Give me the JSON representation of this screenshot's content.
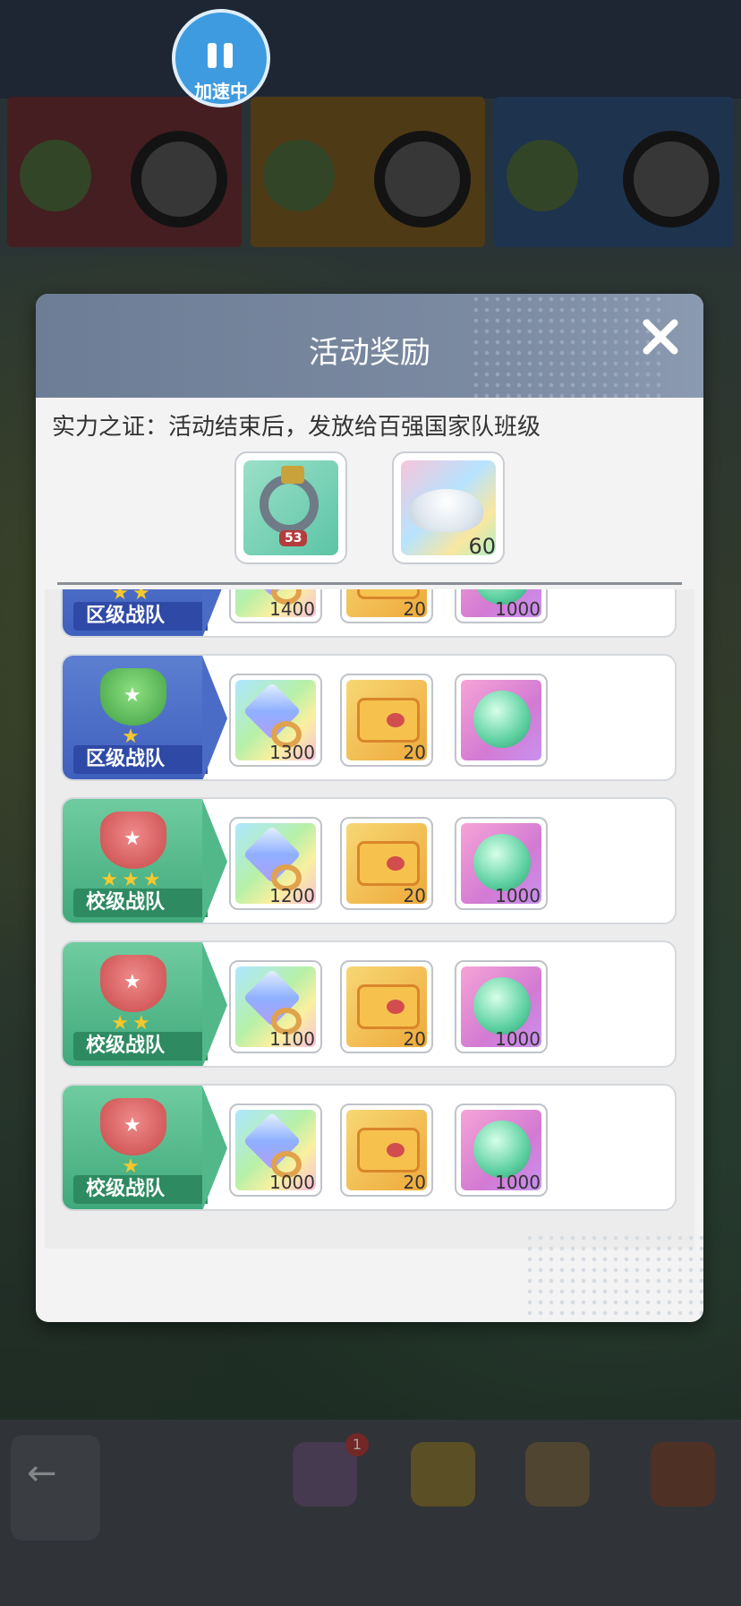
{
  "speed_button": {
    "label": "加速中"
  },
  "modal": {
    "title": "活动奖励",
    "description": "实力之证：活动结束后，发放给百强国家队班级",
    "top_rewards": [
      {
        "icon": "avatar-frame-icon",
        "label": ""
      },
      {
        "icon": "powder-icon",
        "count": "60"
      }
    ],
    "tiers": [
      {
        "rank_label": "区级战队",
        "stars": "★★",
        "medal": "district",
        "rewards": [
          "1400",
          "20",
          "1000"
        ]
      },
      {
        "rank_label": "区级战队",
        "stars": "★",
        "medal": "district",
        "rewards": [
          "1300",
          "20",
          ""
        ]
      },
      {
        "rank_label": "校级战队",
        "stars": "★★★",
        "medal": "school",
        "rewards": [
          "1200",
          "20",
          "1000"
        ]
      },
      {
        "rank_label": "校级战队",
        "stars": "★★",
        "medal": "school",
        "rewards": [
          "1100",
          "20",
          "1000"
        ]
      },
      {
        "rank_label": "校级战队",
        "stars": "★",
        "medal": "school",
        "rewards": [
          "1000",
          "20",
          "1000"
        ]
      }
    ]
  },
  "background": {
    "badge_count": "1"
  },
  "colors": {
    "header": "#7c8ba2",
    "district": "#3f5fbd",
    "school": "#3fa87a"
  }
}
